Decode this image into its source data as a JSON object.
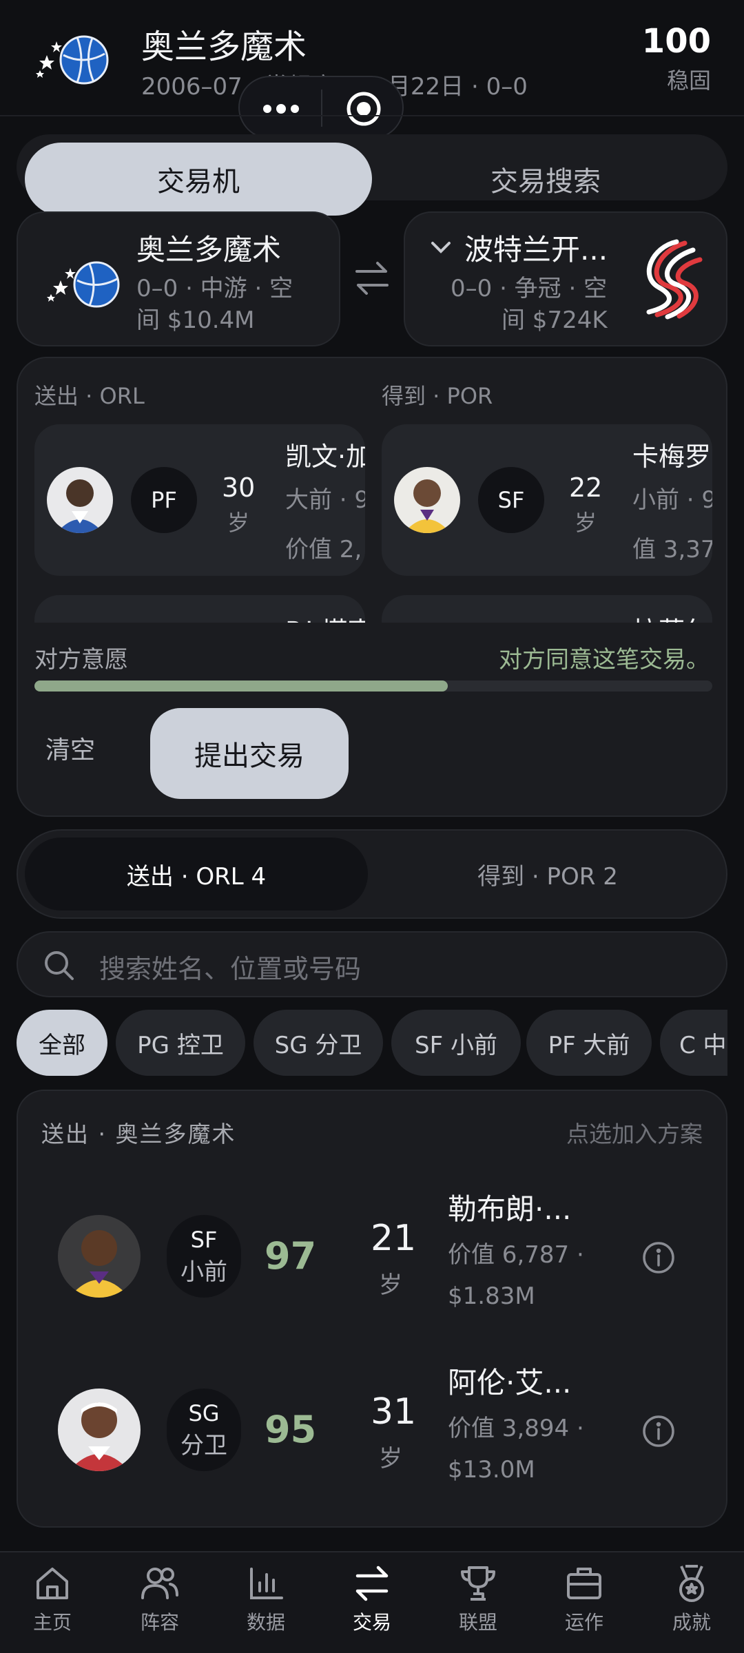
{
  "header": {
    "title": "奥兰多魔术",
    "subtitle": "2006–07 · 常规赛 · 10月22日 · 0–0",
    "rating_value": "100",
    "rating_label": "稳固"
  },
  "mode_tabs": [
    "交易机",
    "交易搜索"
  ],
  "teams": {
    "left": {
      "name": "奥兰多魔术",
      "line1": "0–0 · 中游 · 空",
      "line2": "间 $10.4M"
    },
    "right": {
      "name": "波特兰开...",
      "line1": "0–0 · 争冠 · 空",
      "line2": "间 $724K"
    }
  },
  "trade_panel": {
    "send_label": "送出 · ORL",
    "get_label": "得到 · POR",
    "send_player": {
      "position": "PF",
      "age_num": "30",
      "age_unit": "岁",
      "name": "凯文·加",
      "line1": "大前 · 9",
      "line2": "价值 2,"
    },
    "get_player": {
      "position": "SF",
      "age_num": "22",
      "age_unit": "岁",
      "name": "卡梅罗·",
      "line1": "小前 · 9",
      "line2": "值 3,37"
    },
    "send_player2_name": "P.J.塔克",
    "get_player2_name": "拉菲尔",
    "willingness_label": "对方意愿",
    "willingness_text": "对方同意这笔交易。",
    "willingness_fraction": 0.61,
    "clear_label": "清空",
    "propose_label": "提出交易"
  },
  "side_tabs": [
    "送出 · ORL 4",
    "得到 · POR 2"
  ],
  "search": {
    "placeholder": "搜索姓名、位置或号码"
  },
  "filters": [
    "全部",
    "PG 控卫",
    "SG 分卫",
    "SF 小前",
    "PF 大前",
    "C 中"
  ],
  "roster": {
    "title": "送出 · 奥兰多魔术",
    "hint": "点选加入方案",
    "players": [
      {
        "pos": "SF",
        "pos_cn": "小前",
        "rating": "97",
        "age": "21",
        "age_unit": "岁",
        "name": "勒布朗·...",
        "value": "价值 6,787 ·",
        "salary": "$1.83M"
      },
      {
        "pos": "SG",
        "pos_cn": "分卫",
        "rating": "95",
        "age": "31",
        "age_unit": "岁",
        "name": "阿伦·艾...",
        "value": "价值 3,894 ·",
        "salary": "$13.0M"
      }
    ]
  },
  "bottom_nav": [
    "主页",
    "阵容",
    "数据",
    "交易",
    "联盟",
    "运作",
    "成就"
  ],
  "colors": {
    "accent_green": "#9cba93",
    "pill_light": "#ccd1da",
    "progress_fill": "#8fa88a"
  }
}
